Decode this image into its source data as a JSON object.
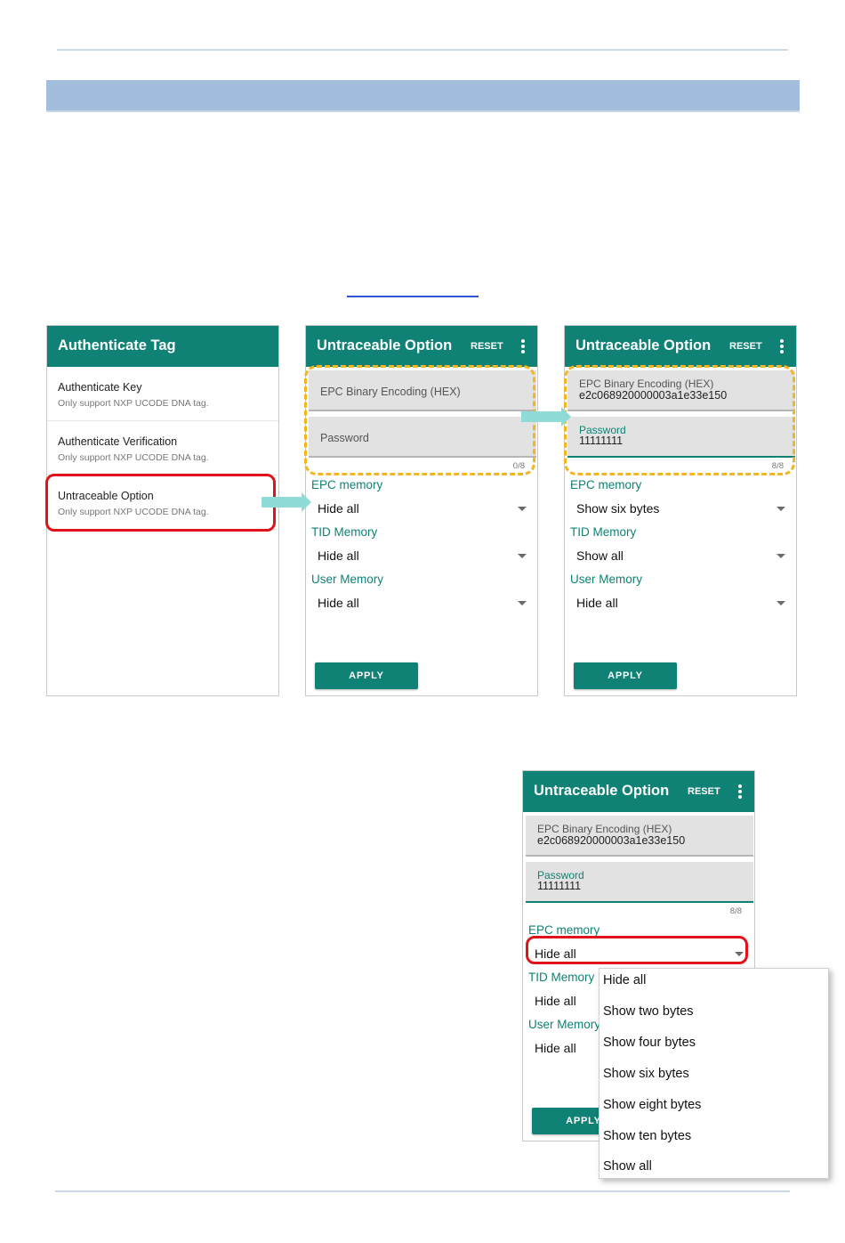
{
  "screen1": {
    "title": "Authenticate Tag",
    "items": [
      {
        "title": "Authenticate Key",
        "subtitle": "Only support NXP UCODE DNA tag."
      },
      {
        "title": "Authenticate Verification",
        "subtitle": "Only support NXP UCODE DNA tag."
      },
      {
        "title": "Untraceable Option",
        "subtitle": "Only support NXP UCODE DNA tag."
      }
    ]
  },
  "screen2": {
    "title": "Untraceable Option",
    "reset_label": "RESET",
    "epc_field_placeholder": "EPC Binary Encoding (HEX)",
    "password_placeholder": "Password",
    "counter": "0/8",
    "epc_memory_label": "EPC memory",
    "epc_memory_value": "Hide all",
    "tid_memory_label": "TID Memory",
    "tid_memory_value": "Hide all",
    "user_memory_label": "User Memory",
    "user_memory_value": "Hide all",
    "apply_label": "APPLY"
  },
  "screen3": {
    "title": "Untraceable Option",
    "reset_label": "RESET",
    "epc_field_label": "EPC Binary Encoding (HEX)",
    "epc_field_value": "e2c068920000003a1e33e150",
    "password_label": "Password",
    "password_value": "11111111",
    "counter": "8/8",
    "epc_memory_label": "EPC memory",
    "epc_memory_value": "Show six bytes",
    "tid_memory_label": "TID Memory",
    "tid_memory_value": "Show all",
    "user_memory_label": "User Memory",
    "user_memory_value": "Hide all",
    "apply_label": "APPLY"
  },
  "screen4": {
    "title": "Untraceable Option",
    "reset_label": "RESET",
    "epc_field_label": "EPC Binary Encoding (HEX)",
    "epc_field_value": "e2c068920000003a1e33e150",
    "password_label": "Password",
    "password_value": "11111111",
    "counter": "8/8",
    "epc_memory_label": "EPC memory",
    "epc_memory_value": "Hide all",
    "tid_memory_label": "TID Memory",
    "tid_memory_value": "Hide all",
    "user_memory_label": "User Memory",
    "user_memory_value": "Hide all",
    "apply_label": "APPLY",
    "dropdown_options": [
      "Hide all",
      "Show two bytes",
      "Show four bytes",
      "Show six bytes",
      "Show eight bytes",
      "Show ten bytes",
      "Show all"
    ]
  },
  "colors": {
    "app_bar": "#0f8275",
    "accent": "#0f8275",
    "section_bar": "#a3bedc",
    "highlight_red": "#e0121a",
    "highlight_yellow": "#f3b520",
    "arrow": "#8fdbd8"
  }
}
